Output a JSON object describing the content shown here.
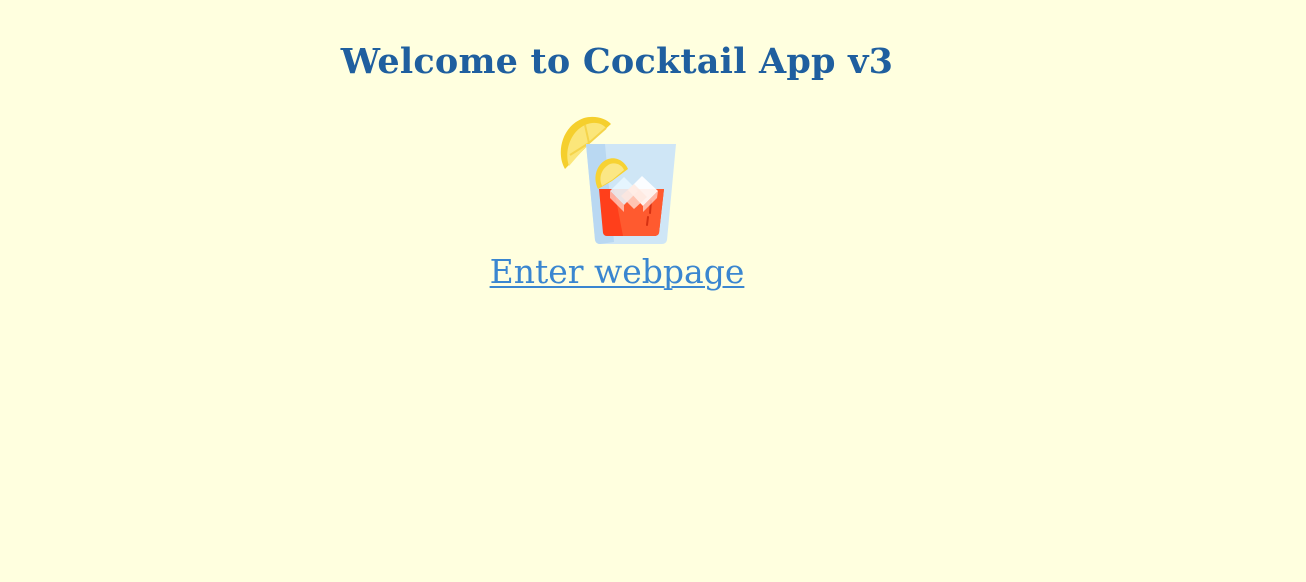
{
  "page": {
    "title": "Welcome to Cocktail App v3",
    "link_text": "Enter webpage",
    "logo_icon": "cocktail-glass-icon"
  },
  "colors": {
    "background": "#ffffdf",
    "title": "#1f5f9f",
    "link": "#3a86d0",
    "lemon": "#f8d430",
    "glass": "#cfe6f6",
    "drink": "#ff4a21"
  }
}
